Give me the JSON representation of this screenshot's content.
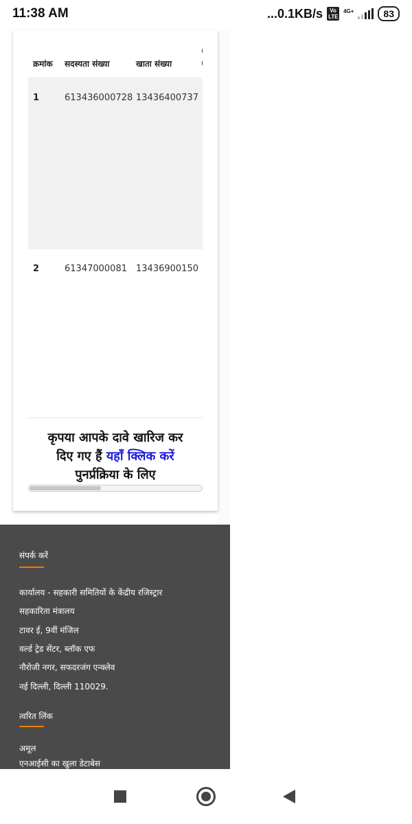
{
  "status_bar": {
    "time": "11:38 AM",
    "net_speed": "...0.1KB/s",
    "volte": "Vo LTE",
    "network": "4G+",
    "battery": "83"
  },
  "table": {
    "headers": [
      "क्रमांक",
      "सदस्यता संख्या",
      "खाता संख्या"
    ],
    "truncated_header": "( \n(",
    "rows": [
      {
        "index": "1",
        "membership_no": "613436000728",
        "account_no": "13436400737"
      },
      {
        "index": "2",
        "membership_no": "61347000081",
        "account_no": "13436900150"
      }
    ]
  },
  "message": {
    "line_a": "कृपया आपके दावे खारिज कर",
    "line_b_prefix": "दिए गए हैं ",
    "link_text": "यहाँ क्लिक करें",
    "line_c": "पुनर्प्रक्रिया के लिए"
  },
  "footer": {
    "contact_title": "संपर्क करें",
    "address": [
      "कार्यालय - सहकारी समितियों के केंद्रीय रजिस्ट्रार",
      "सहकारिता मंत्रालय",
      "टावर ई, 9वीं मंजिल",
      "वर्ल्ड ट्रेड सेंटर, ब्लॉक एफ",
      "नौरोजी नगर, सफदरजंग एन्क्लेव",
      "नई दिल्ली, दिल्ली 110029."
    ],
    "quick_links_title": "त्वरित लिंक",
    "links": [
      "अमूल",
      "एनआईसी का खुला डेटाबेस"
    ]
  },
  "colors": {
    "link": "#1a1ad6",
    "accent": "#f57c00",
    "footer_bg": "#4a4a4a"
  }
}
